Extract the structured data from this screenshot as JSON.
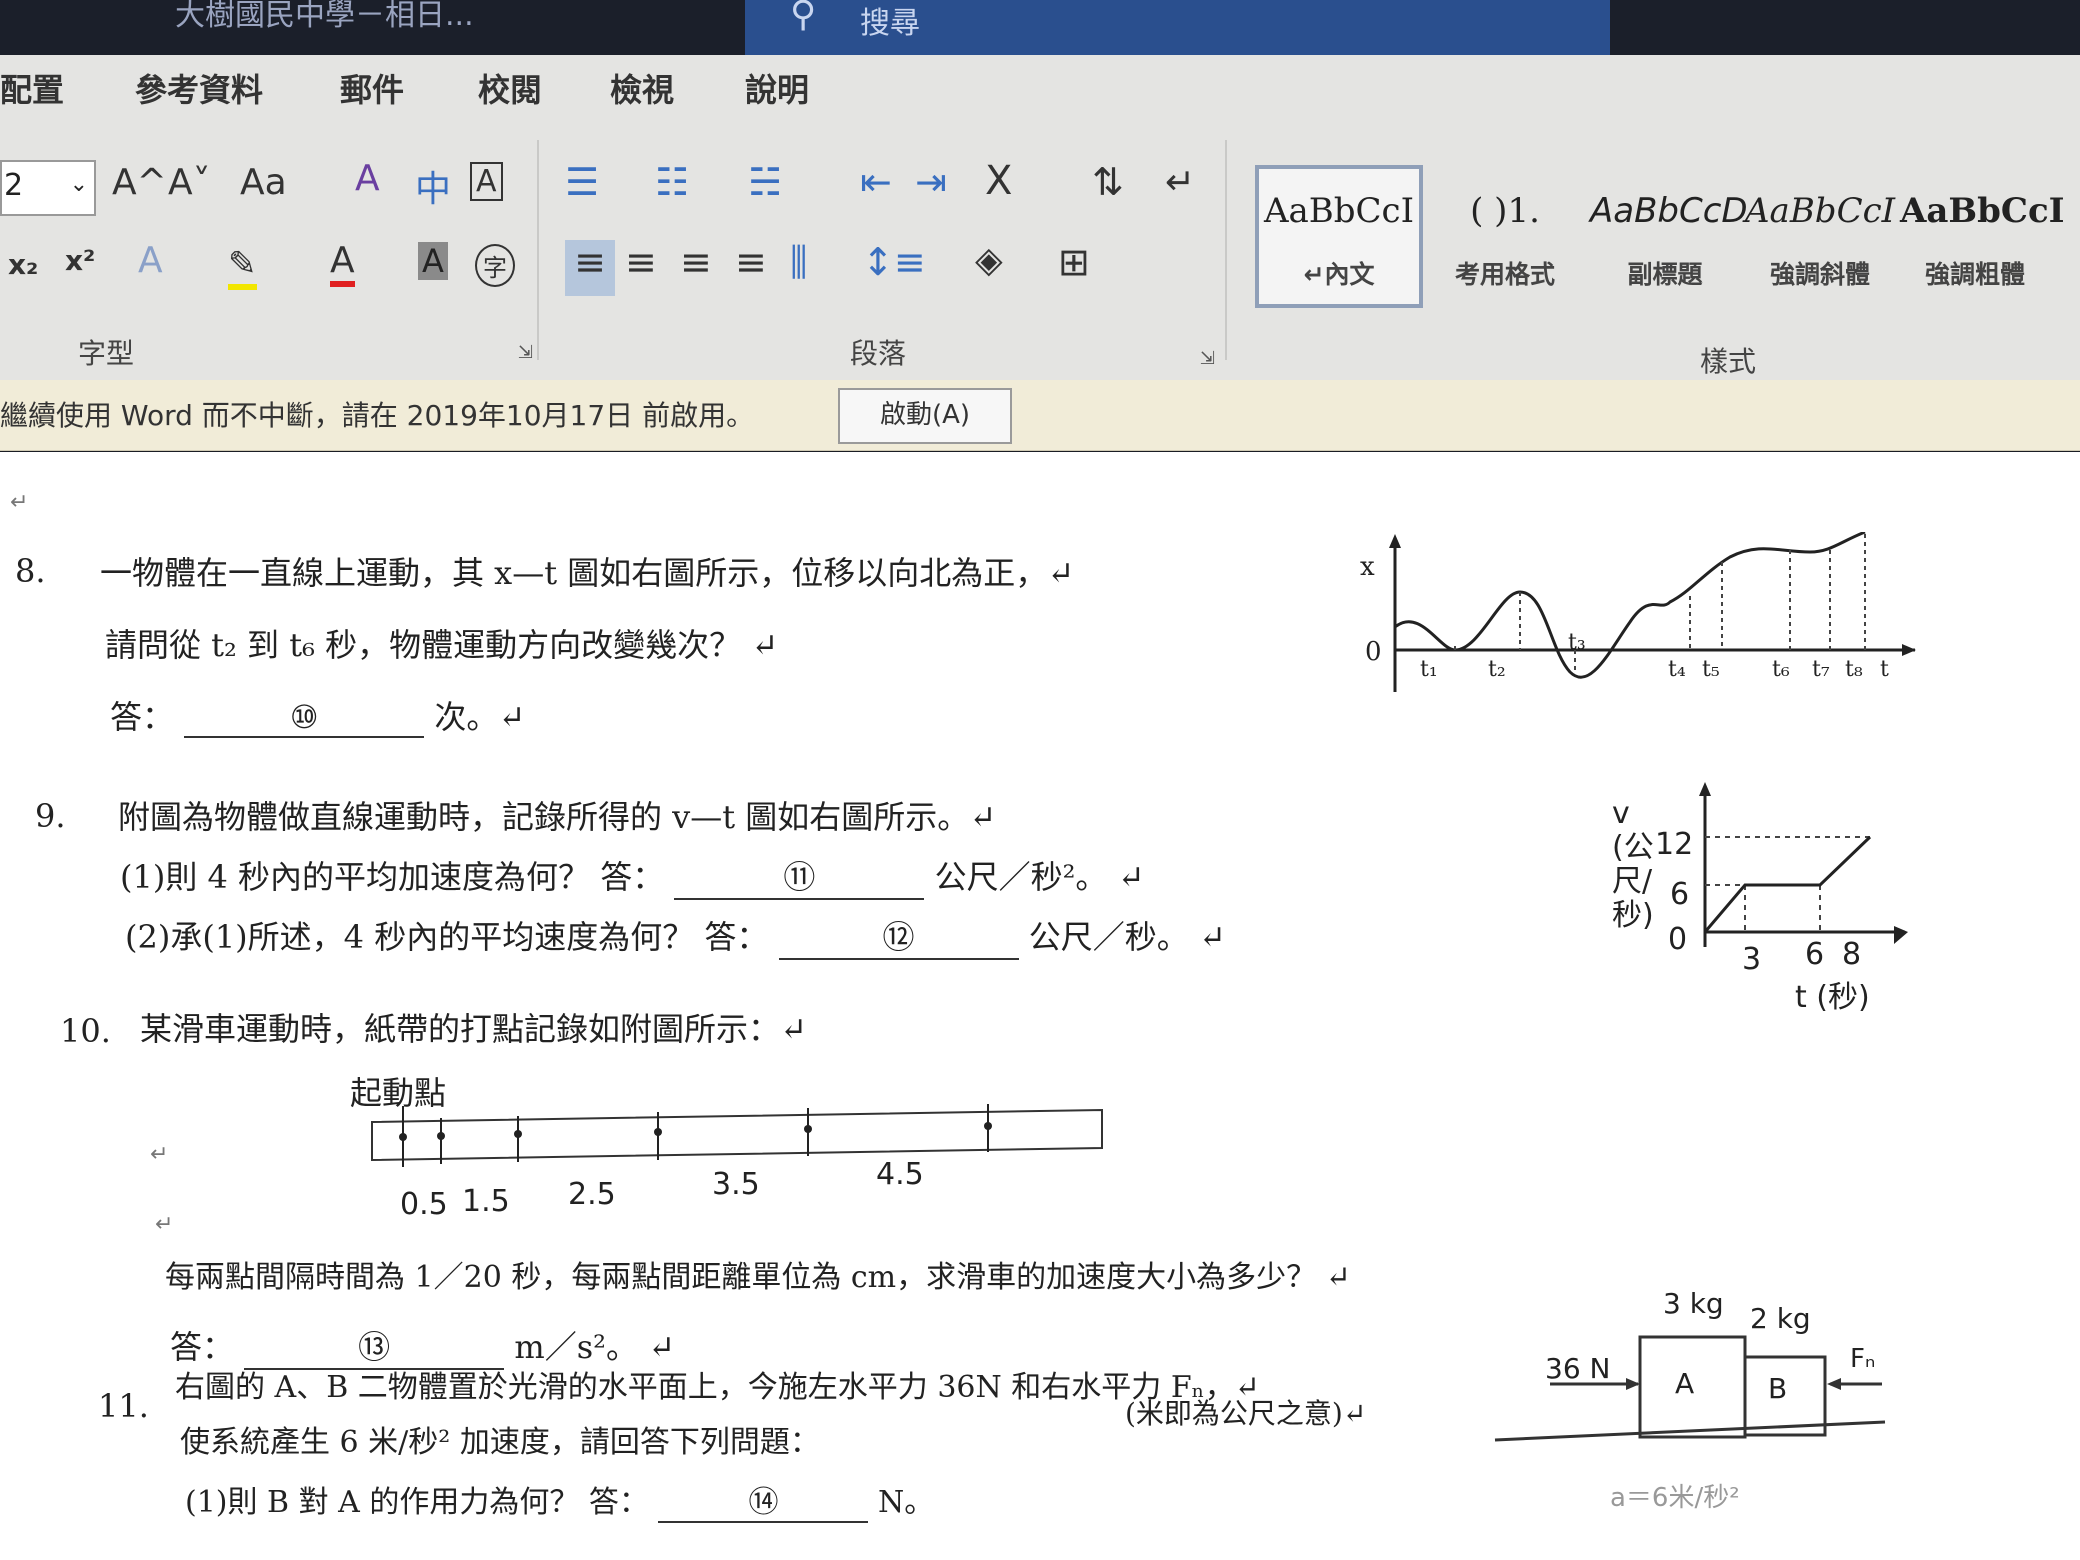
{
  "titlebar": {
    "title": "大樹國民中學－相日...",
    "search_label": "搜尋"
  },
  "tabs": [
    "配置",
    "參考資料",
    "郵件",
    "校閱",
    "檢視",
    "說明"
  ],
  "font_group": {
    "size_value": "2",
    "label": "字型",
    "tools": [
      "A^",
      "A˅",
      "Aa",
      "A",
      "中",
      "A",
      "x₂",
      "x²",
      "A",
      "A",
      "A",
      "字"
    ]
  },
  "paragraph_group": {
    "label": "段落"
  },
  "styles_group": {
    "label": "樣式",
    "items": [
      {
        "sample": "AaBbCcI",
        "name": "↵內文"
      },
      {
        "sample": "(  )1.",
        "name": "考用格式"
      },
      {
        "sample": "AaBbCcD",
        "name": "副標題"
      },
      {
        "sample": "AaBbCcI",
        "name": "強調斜體"
      },
      {
        "sample": "AaBbCcI",
        "name": "強調粗體"
      }
    ]
  },
  "infobar": {
    "message": "繼續使用 Word 而不中斷，請在 2019年10月17日 前啟用。",
    "button": "啟動(A)"
  },
  "doc": {
    "q8": {
      "num": "8.",
      "line1": "一物體在一直線上運動，其 x—t 圖如右圖所示，位移以向北為正，↵",
      "line2": "請問從 t₂ 到 t₆ 秒，物體運動方向改變幾次？ ↵",
      "ans_label": "答：",
      "ans_no": "⑩",
      "ans_unit": "次。↵"
    },
    "q9": {
      "num": "9.",
      "line1": "附圖為物體做直線運動時，記錄所得的 v—t 圖如右圖所示。↵",
      "p1": "(1)則 4 秒內的平均加速度為何？  答：",
      "p1_no": "⑪",
      "p1_unit": "公尺／秒²。    ↵",
      "p2": "(2)承(1)所述，4 秒內的平均速度為何？  答：",
      "p2_no": "⑫",
      "p2_unit": "公尺／秒。    ↵"
    },
    "q10": {
      "num": "10.",
      "line1": "某滑車運動時，紙帶的打點記錄如附圖所示：↵",
      "start_label": "起動點",
      "tape_labels": [
        "0.5",
        "1.5",
        "2.5",
        "3.5",
        "4.5"
      ],
      "line2": "每兩點間隔時間為 1／20 秒，每兩點間距離單位為 cm，求滑車的加速度大小為多少？ ↵",
      "ans_label": "答：",
      "ans_no": "⑬",
      "ans_unit": "m／s²。 ↵"
    },
    "q11": {
      "num": "11.",
      "line1": "右圖的 A、B 二物體置於光滑的水平面上，今施左水平力 36N 和右水平力 Fₙ，↵",
      "line2": "使系統產生 6 米/秒² 加速度，請回答下列問題：",
      "note": "(米即為公尺之意)↵",
      "p1": "(1)則 B 對 A 的作用力為何？  答：",
      "p1_no": "⑭",
      "p1_unit": "N。"
    }
  },
  "xt_graph": {
    "y_label": "x",
    "origin": "0",
    "ticks": [
      "t₁",
      "t₂",
      "t₃",
      "t₄",
      "t₅",
      "t₆",
      "t₇",
      "t₈",
      "t"
    ]
  },
  "vt_graph": {
    "y_label": "v (公尺/秒)",
    "x_label": "t (秒)",
    "y_ticks": [
      "12",
      "6",
      "0"
    ],
    "x_ticks": [
      "3",
      "6",
      "8"
    ]
  },
  "block_fig": {
    "mass_a": "3 kg",
    "mass_b": "2 kg",
    "force_left": "36 N",
    "label_a": "A",
    "label_b": "B",
    "force_right": "Fₙ",
    "accel": "a＝6米/秒²"
  }
}
